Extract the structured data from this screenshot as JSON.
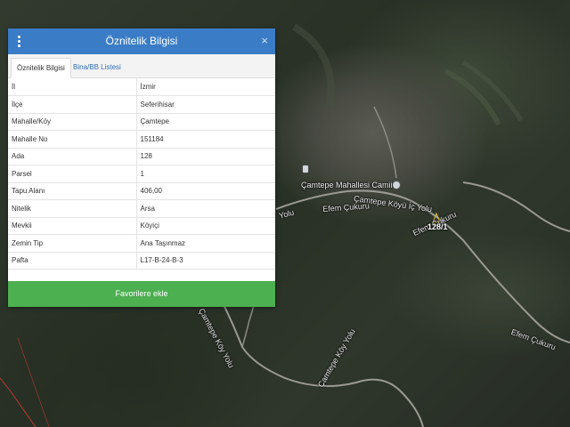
{
  "panel": {
    "title": "Öznitelik Bilgisi",
    "close_symbol": "×",
    "tabs": [
      {
        "label": "Öznitelik Bilgisi",
        "active": true
      },
      {
        "label": "Bina/BB Listesi",
        "active": false
      }
    ],
    "rows": [
      {
        "key": "İl",
        "value": "İzmir"
      },
      {
        "key": "İlçe",
        "value": "Seferihisar"
      },
      {
        "key": "Mahalle/Köy",
        "value": "Çamtepe"
      },
      {
        "key": "Mahalle No",
        "value": "151184"
      },
      {
        "key": "Ada",
        "value": "128"
      },
      {
        "key": "Parsel",
        "value": "1"
      },
      {
        "key": "Tapu Alanı",
        "value": "406,00"
      },
      {
        "key": "Nitelik",
        "value": "Arsa"
      },
      {
        "key": "Mevkii",
        "value": "Köyiçi"
      },
      {
        "key": "Zemin Tip",
        "value": "Ana Taşınmaz"
      },
      {
        "key": "Pafta",
        "value": "L17-B-24-B-3"
      }
    ],
    "favorite_button": "Favorilere ekle",
    "header_color": "#3a7dc6",
    "button_color": "#4caf50"
  },
  "map": {
    "labels": {
      "mosque": "Çamtepe Mahallesi Camii",
      "koy_ici_yolu": "Çamtepe Köyü İç Yolu",
      "efem_cukuru_1": "Efem Çukuru",
      "efem_cukuru_2": "Efem Çukuru",
      "efem_cukuru_3": "Efem Çukuru",
      "koy_yolu_left": "Çamtepe Köy Yolu",
      "koy_yolu_right": "Çamtepe Köy Yolu",
      "yolu_fragment": "Yolu",
      "parcel_badge": "128/1"
    }
  }
}
